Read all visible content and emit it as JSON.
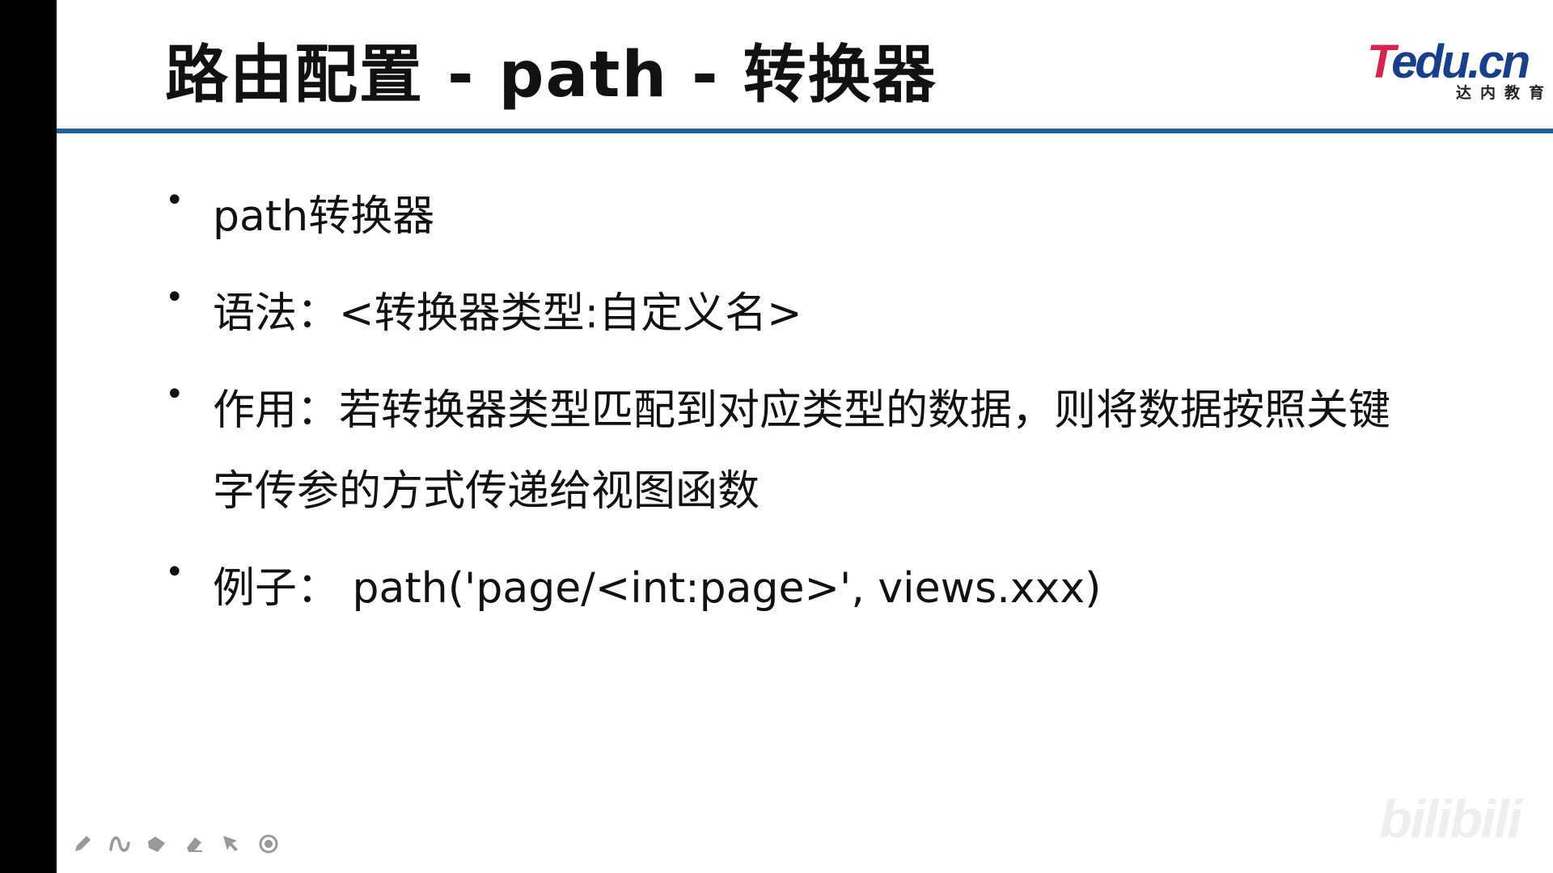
{
  "slide": {
    "title": "路由配置 - path - 转换器",
    "logo": {
      "main_t": "T",
      "main_rest": "edu.cn",
      "sub": "达内教育"
    },
    "bullets": [
      {
        "text": "path转换器"
      },
      {
        "text": "语法：<转换器类型:自定义名>"
      },
      {
        "text": "作用：若转换器类型匹配到对应类型的数据，则将数据按照关键",
        "continuation": "字传参的方式传递给视图函数"
      },
      {
        "text": "例子：  path('page/<int:page>', views.xxx)"
      }
    ],
    "bullet_glyph": "•"
  },
  "toolbar": {
    "tools": [
      "pen-icon",
      "curve-icon",
      "fill-icon",
      "eraser-icon",
      "pointer-icon",
      "record-icon"
    ]
  },
  "watermark": "bilibili",
  "colors": {
    "rule": "#1f5fa6",
    "logo_red": "#d9234f",
    "logo_blue": "#1a3f8a"
  }
}
